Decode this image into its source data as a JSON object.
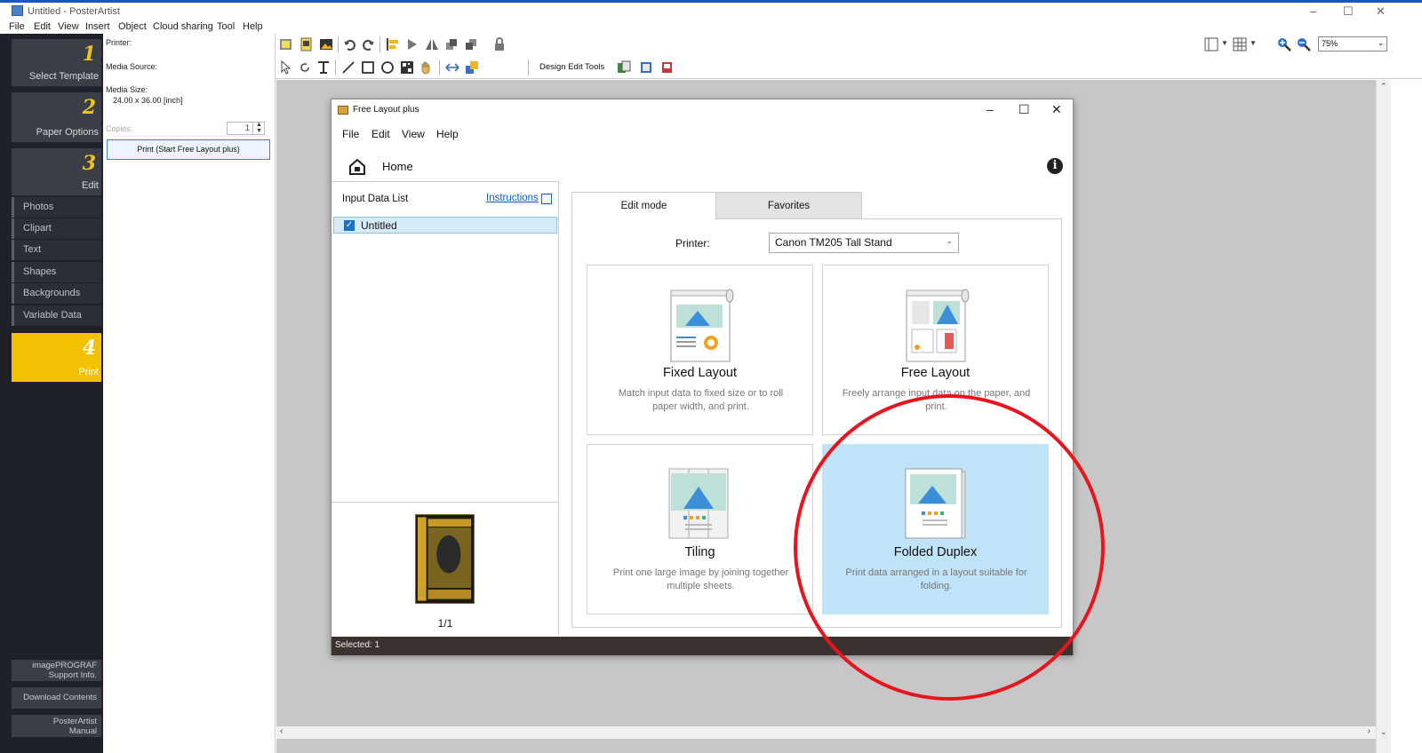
{
  "window": {
    "title": "Untitled - PosterArtist",
    "controls": [
      "–",
      "☐",
      "✕"
    ]
  },
  "menu": [
    "File",
    "Edit",
    "View",
    "Insert",
    "Object",
    "Cloud sharing",
    "Tool",
    "Help"
  ],
  "steps": [
    {
      "num": "1",
      "label": "Select Template"
    },
    {
      "num": "2",
      "label": "Paper Options"
    },
    {
      "num": "3",
      "label": "Edit"
    },
    {
      "num": "4",
      "label": "Print"
    }
  ],
  "edit_items": [
    "Photos",
    "Clipart",
    "Text",
    "Shapes",
    "Backgrounds",
    "Variable Data"
  ],
  "bottom_buttons": [
    {
      "line1": "imagePROGRAF",
      "line2": "Support Info."
    },
    {
      "line1": "Download Contents",
      "line2": ""
    },
    {
      "line1": "PosterArtist",
      "line2": "Manual"
    }
  ],
  "panel": {
    "printer_label": "Printer:",
    "media_source_label": "Media Source:",
    "media_size_label": "Media Size:",
    "media_size_value": "24.00 x 36.00 [inch]",
    "copies_label": "Copies:",
    "copies_value": "1",
    "print_button": "Print (Start Free Layout plus)"
  },
  "toolbar": {
    "design_edit_tools": "Design Edit Tools",
    "zoom": "75%"
  },
  "dialog": {
    "title": "Free Layout plus",
    "menu": [
      "File",
      "Edit",
      "View",
      "Help"
    ],
    "home_label": "Home",
    "input_list_title": "Input Data List",
    "instructions_link": "Instructions",
    "list_items": [
      "Untitled"
    ],
    "page_counter": "1/1",
    "tabs": [
      "Edit mode",
      "Favorites"
    ],
    "printer_label": "Printer:",
    "printer_value": "Canon TM205 Tall Stand",
    "cards": [
      {
        "title": "Fixed Layout",
        "desc": "Match input data to fixed size or to roll paper width, and print."
      },
      {
        "title": "Free Layout",
        "desc": "Freely arrange input data on the paper, and print."
      },
      {
        "title": "Tiling",
        "desc": "Print one large image by joining together multiple sheets."
      },
      {
        "title": "Folded Duplex",
        "desc": "Print data arranged in a layout suitable for folding."
      }
    ],
    "selected_card": "Folded Duplex",
    "status": "Selected: 1"
  },
  "colors": {
    "accent_print": "#f2c200",
    "selection": "#bfe3f8",
    "annotation_circle": "#e8141e",
    "link": "#0b5cc8"
  }
}
